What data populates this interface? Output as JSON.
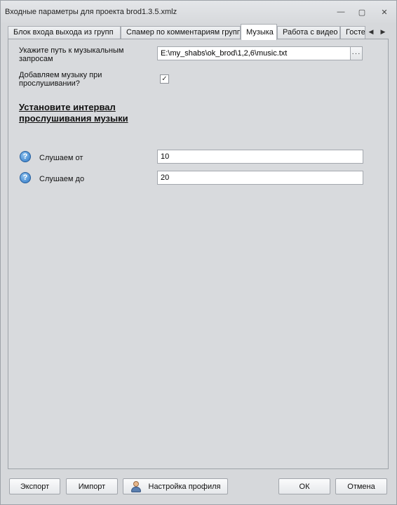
{
  "window": {
    "title": "Входные параметры для проекта brod1.3.5.xmlz",
    "controls": {
      "minimize": "—",
      "restore": "▢",
      "close": "✕"
    }
  },
  "tabs": [
    {
      "label": "Блок входа выхода из групп",
      "active": false
    },
    {
      "label": "Спамер по комментариям групп",
      "active": false
    },
    {
      "label": "Музыка",
      "active": true
    },
    {
      "label": "Работа с видео",
      "active": false
    },
    {
      "label": "Гостевые",
      "active": false
    }
  ],
  "tab_scroll": {
    "left": "◀",
    "right": "▶"
  },
  "music": {
    "path_label": "Укажите путь к музыкальным запросам",
    "path_value": "E:\\my_shabs\\ok_brod\\1,2,6\\music.txt",
    "browse_label": "···",
    "add_music_label": "Добавляем музыку при прослушивании?",
    "add_music_checked": true,
    "add_music_mark": "✓",
    "interval_header": "Установите интервал прослушивания музыки",
    "help_glyph": "?",
    "listen_from_label": "Слушаем от",
    "listen_from_value": "10",
    "listen_to_label": "Слушаем до",
    "listen_to_value": "20"
  },
  "footer": {
    "export_label": "Экспорт",
    "import_label": "Импорт",
    "profile_label": "Настройка профиля",
    "ok_label": "ОК",
    "cancel_label": "Отмена"
  },
  "icons": {
    "help": "help-icon",
    "profile": "profile-icon",
    "checkbox_mark": "check-icon"
  },
  "colors": {
    "window_bg": "#d6d8db",
    "active_tab_bg": "#ffffff",
    "help_icon": "#2f77c4"
  }
}
